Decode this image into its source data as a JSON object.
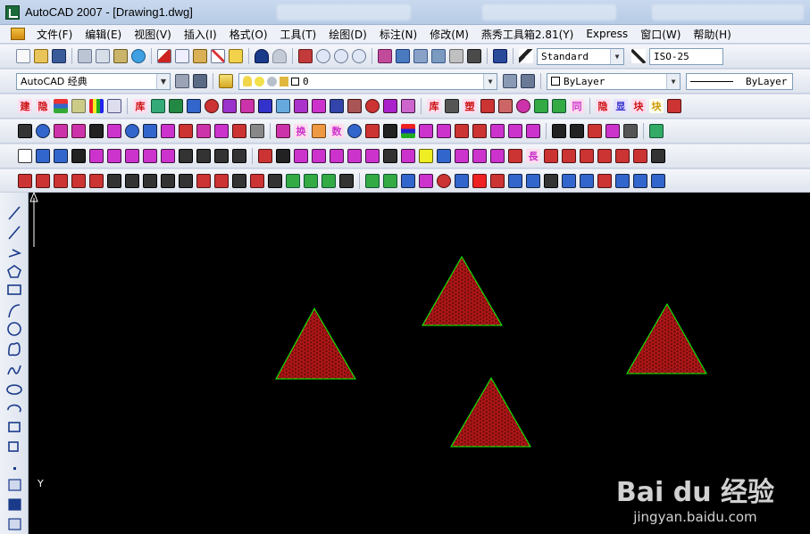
{
  "window": {
    "title": "AutoCAD 2007 - [Drawing1.dwg]"
  },
  "menu": {
    "items": [
      "文件(F)",
      "编辑(E)",
      "视图(V)",
      "插入(I)",
      "格式(O)",
      "工具(T)",
      "绘图(D)",
      "标注(N)",
      "修改(M)",
      "燕秀工具箱2.81(Y)",
      "Express",
      "窗口(W)",
      "帮助(H)"
    ]
  },
  "toolbars": {
    "text_style": "Standard",
    "dim_style": "ISO-25",
    "workspace": "AutoCAD 经典",
    "layer": "0",
    "color": "ByLayer",
    "linetype": "ByLayer"
  },
  "drawing": {
    "background": "#000000",
    "hatch_fill": "#8b1010",
    "hatch_lines": "#d02020",
    "outline": "#00ff00",
    "ucs_y_label": "Y"
  },
  "watermark": {
    "logo": "Bai du 经验",
    "url": "jingyan.baidu.com"
  }
}
